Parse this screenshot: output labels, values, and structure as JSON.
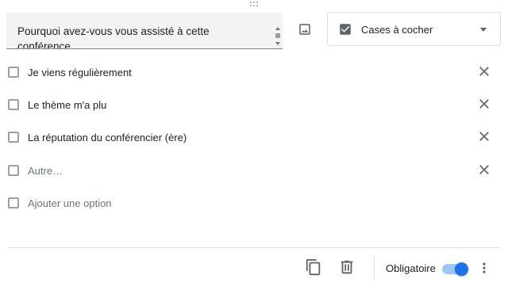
{
  "question": {
    "text": "Pourquoi avez-vous vous assisté  à cette conférence"
  },
  "icons": {
    "drag": "drag-handle-icon",
    "image": "image-icon",
    "checkbox": "checkbox-checked-icon",
    "dropdown": "caret-down-icon",
    "remove": "close-icon",
    "copy": "copy-icon",
    "delete": "trash-icon",
    "more": "more-vert-icon"
  },
  "type_select": {
    "selected": "Cases à cocher"
  },
  "options": [
    {
      "label": "Je viens régulièrement"
    },
    {
      "label": "Le thème m'a plu"
    },
    {
      "label": "La réputation du conférencier (ère)"
    },
    {
      "label": "Autre…"
    }
  ],
  "add_option": {
    "label": "Ajouter une option"
  },
  "footer": {
    "required_label": "Obligatoire",
    "required_on": true
  },
  "colors": {
    "accent": "#1a73e8",
    "toggle_track": "#9ac8f3",
    "question_bg": "#f1f3f4",
    "border": "#dadce0"
  }
}
